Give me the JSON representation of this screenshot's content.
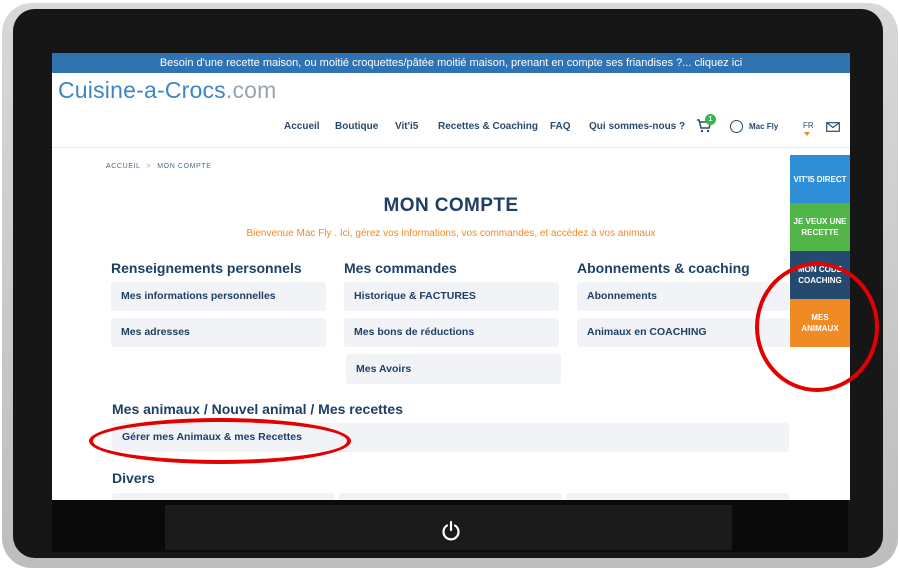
{
  "banner": {
    "text": "Besoin d'une recette maison, ou moitié croquettes/pâtée moitié maison, prenant en compte ses friandises ?... cliquez ici"
  },
  "logo": {
    "main": "Cuisine-a-Crocs",
    "suffix": ".com"
  },
  "nav": {
    "items": [
      "Accueil",
      "Boutique",
      "Vit'i5",
      "Recettes & Coaching",
      "FAQ",
      "Qui sommes-nous ?"
    ],
    "cart_count": "1",
    "user_name": "Mac Fly",
    "lang": "FR"
  },
  "breadcrumb": {
    "home": "ACCUEIL",
    "separator": ">",
    "current": "MON COMPTE"
  },
  "page": {
    "title": "MON COMPTE",
    "welcome": "Bienvenue Mac Fly . Ici, gérez vos informations, vos commandes, et accèdez à vos animaux"
  },
  "sections": {
    "personal": {
      "title": "Renseignements personnels",
      "items": [
        "Mes informations personnelles",
        "Mes adresses"
      ]
    },
    "orders": {
      "title": "Mes commandes",
      "items": [
        "Historique & FACTURES",
        "Mes bons de réductions",
        "Mes Avoirs"
      ]
    },
    "subscriptions": {
      "title": "Abonnements & coaching",
      "items": [
        "Abonnements",
        "Animaux en COACHING"
      ]
    },
    "animals": {
      "title": "Mes animaux / Nouvel animal / Mes recettes",
      "items": [
        "Gérer mes Animaux & mes Recettes"
      ]
    },
    "misc": {
      "title": "Divers"
    }
  },
  "side_tabs": [
    {
      "label": "VIT'I5 DIRECT",
      "color": "#2e8fd6"
    },
    {
      "label": "JE VEUX UNE RECETTE",
      "color": "#52b548"
    },
    {
      "label": "MON CODE COACHING",
      "color": "#244a6f"
    },
    {
      "label": "MES ANIMAUX",
      "color": "#f08a24"
    }
  ],
  "colors": {
    "banner": "#2f73b3",
    "accent": "#f08a24",
    "heading": "#1e3f66",
    "highlight_ring": "#e40000"
  }
}
